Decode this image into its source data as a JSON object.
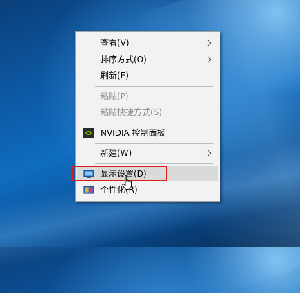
{
  "context_menu": {
    "items": [
      {
        "label": "查看(V)",
        "disabled": false,
        "submenu": true
      },
      {
        "label": "排序方式(O)",
        "disabled": false,
        "submenu": true
      },
      {
        "label": "刷新(E)",
        "disabled": false,
        "submenu": false
      },
      {
        "label": "粘贴(P)",
        "disabled": true,
        "submenu": false
      },
      {
        "label": "粘贴快捷方式(S)",
        "disabled": true,
        "submenu": false
      },
      {
        "label": "NVIDIA 控制面板",
        "disabled": false,
        "submenu": false,
        "icon": "nvidia-icon"
      },
      {
        "label": "新建(W)",
        "disabled": false,
        "submenu": true
      },
      {
        "label": "显示设置(D)",
        "disabled": false,
        "submenu": false,
        "icon": "display-icon",
        "hovered": true
      },
      {
        "label": "个性化(R)",
        "disabled": false,
        "submenu": false,
        "icon": "personalize-icon"
      }
    ]
  },
  "colors": {
    "highlight_box": "#e01b1b",
    "menu_background": "#f2f2f2",
    "hover_background": "#dadada",
    "disabled_text": "#8c8c8c"
  }
}
